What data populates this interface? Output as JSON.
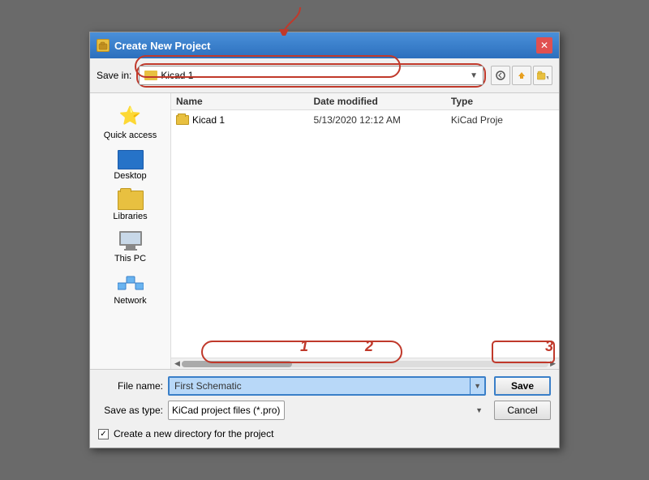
{
  "dialog": {
    "title": "Create New Project",
    "save_in_label": "Save in:",
    "save_in_value": "Kicad 1",
    "columns": {
      "name": "Name",
      "date_modified": "Date modified",
      "type": "Type"
    },
    "files": [
      {
        "name": "Kicad 1",
        "date": "5/13/2020 12:12 AM",
        "type": "KiCad Proje"
      }
    ],
    "file_name_label": "File name:",
    "file_name_value": "First Schematic",
    "save_as_type_label": "Save as type:",
    "save_as_type_value": "KiCad project files (*.pro)",
    "save_button": "Save",
    "cancel_button": "Cancel",
    "checkbox_label": "Create a new directory for the project",
    "checkbox_checked": true
  },
  "sidebar": {
    "items": [
      {
        "label": "Quick access",
        "icon": "star"
      },
      {
        "label": "Desktop",
        "icon": "desktop"
      },
      {
        "label": "Libraries",
        "icon": "libraries"
      },
      {
        "label": "This PC",
        "icon": "computer"
      },
      {
        "label": "Network",
        "icon": "network"
      }
    ]
  },
  "annotations": {
    "number1": "1",
    "number2": "2",
    "number3": "3"
  }
}
